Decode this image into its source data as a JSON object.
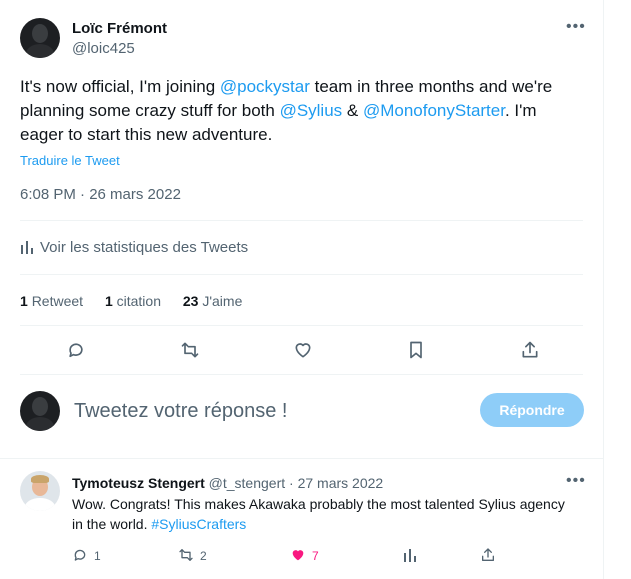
{
  "author": {
    "name": "Loïc Frémont",
    "handle": "@loic425"
  },
  "tweet": {
    "text_before": "It's now official, I'm joining ",
    "mention_1": "@pockystar",
    "text_middle_1": " team in three months and we're planning some crazy stuff for both ",
    "mention_2": "@Sylius",
    "text_middle_2": " & ",
    "mention_3": "@MonofonyStarter",
    "text_after": ". I'm eager to start this new adventure.",
    "translate_label": "Traduire le Tweet",
    "timestamp": "6:08 PM · 26 mars 2022"
  },
  "stats": {
    "label": "Voir les statistiques des Tweets"
  },
  "counts": {
    "retweets_num": "1",
    "retweets_label": "Retweet",
    "citations_num": "1",
    "citations_label": "citation",
    "likes_num": "23",
    "likes_label": "J'aime"
  },
  "compose": {
    "placeholder": "Tweetez votre réponse !",
    "button_label": "Répondre"
  },
  "reply": {
    "name": "Tymoteusz Stengert",
    "handle": "@t_stengert",
    "date": "· 27 mars 2022",
    "text": "Wow. Congrats! This makes Akawaka probably the most talented Sylius agency in the world. ",
    "hashtag": "#SyliusCrafters",
    "replies": "1",
    "retweets": "2",
    "likes": "7"
  },
  "icons": {
    "more": "more-horizontal-icon",
    "stats": "bar-chart-icon",
    "reply": "comment-icon",
    "retweet": "retweet-icon",
    "like": "heart-icon",
    "bookmark": "bookmark-icon",
    "share": "share-icon"
  },
  "colors": {
    "accent": "#1d9bf0",
    "secondary_text": "#536471",
    "like_active": "#f91880",
    "button_disabled": "#8ecdf8"
  }
}
